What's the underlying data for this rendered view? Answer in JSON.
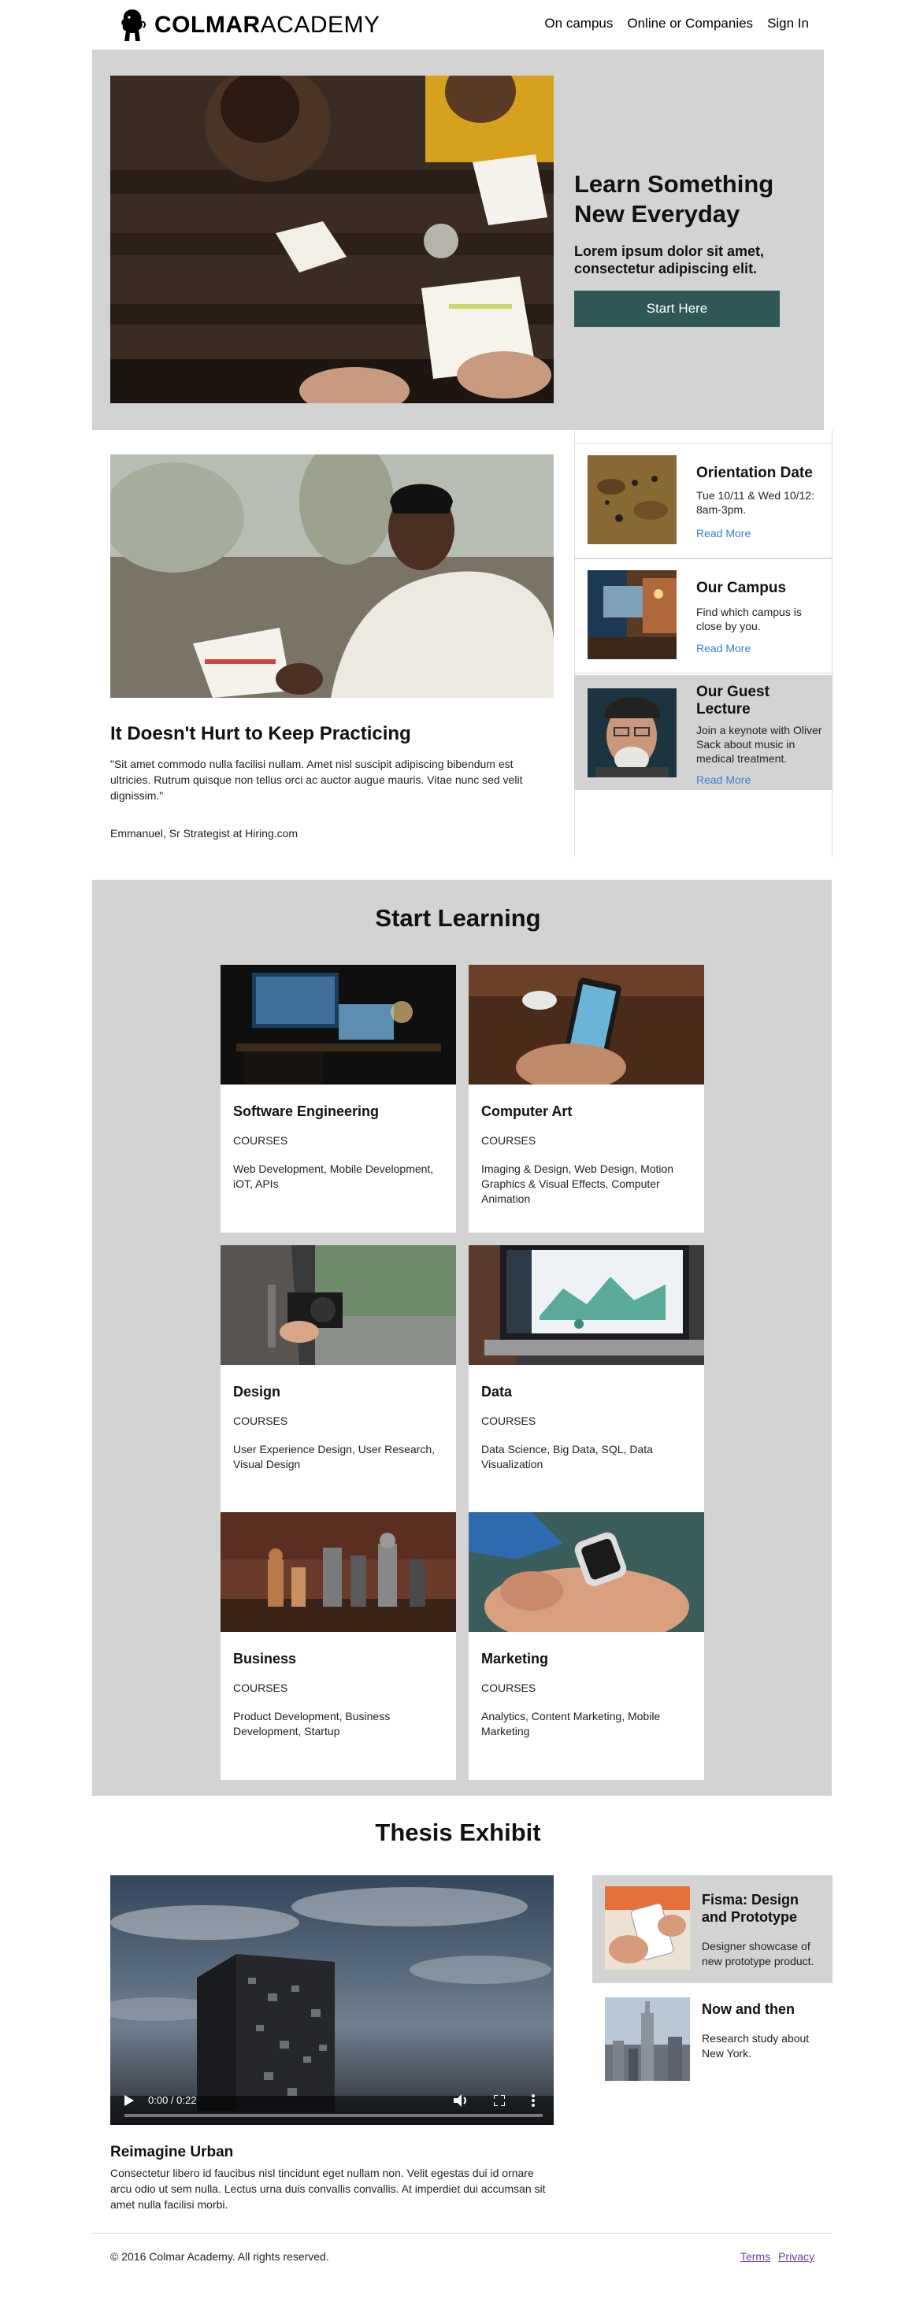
{
  "header": {
    "logo_bold": "COLMAR",
    "logo_light": "ACADEMY",
    "nav": [
      "On campus",
      "Online or Companies",
      "Sign In"
    ]
  },
  "hero": {
    "title": "Learn Something New Everyday",
    "subtitle": "Lorem ipsum dolor sit amet, consectetur adipiscing elit.",
    "button": "Start Here"
  },
  "testimonial": {
    "title": "It Doesn't Hurt to Keep Practicing",
    "quote": "\"Sit amet commodo nulla facilisi nullam. Amet nisl suscipit adipiscing bibendum est ultricies. Rutrum quisque non tellus orci ac auctor augue mauris. Vitae nunc sed velit dignissim.\"",
    "author": "Emmanuel, Sr Strategist at Hiring.com"
  },
  "events": [
    {
      "title": "Orientation Date",
      "desc": "Tue 10/11 & Wed 10/12: 8am-3pm.",
      "link": "Read More"
    },
    {
      "title": "Our Campus",
      "desc": "Find which campus is close by you.",
      "link": "Read More"
    },
    {
      "title": "Our Guest Lecture",
      "desc": "Join a keynote with Oliver Sack about music in medical treatment.",
      "link": "Read More"
    }
  ],
  "learning": {
    "title": "Start Learning",
    "courses": [
      {
        "title": "Software Engineering",
        "label": "COURSES",
        "desc": "Web Development, Mobile Development, iOT, APIs"
      },
      {
        "title": "Computer Art",
        "label": "COURSES",
        "desc": "Imaging & Design, Web Design, Motion Graphics & Visual Effects, Computer Animation"
      },
      {
        "title": "Design",
        "label": "COURSES",
        "desc": "User Experience Design, User Research, Visual Design"
      },
      {
        "title": "Data",
        "label": "COURSES",
        "desc": "Data Science, Big Data, SQL, Data Visualization"
      },
      {
        "title": "Business",
        "label": "COURSES",
        "desc": "Product Development, Business Development, Startup"
      },
      {
        "title": "Marketing",
        "label": "COURSES",
        "desc": "Analytics, Content Marketing, Mobile Marketing"
      }
    ]
  },
  "thesis": {
    "title": "Thesis Exhibit",
    "video_time": "0:00 / 0:22",
    "main_title": "Reimagine Urban",
    "main_desc": "Consectetur libero id faucibus nisl tincidunt eget nullam non. Velit egestas dui id ornare arcu odio ut sem nulla. Lectus urna duis convallis convallis. At imperdiet dui accumsan sit amet nulla facilisi morbi.",
    "projects": [
      {
        "title": "Fisma: Design and Prototype",
        "desc": "Designer showcase of new prototype product."
      },
      {
        "title": "Now and then",
        "desc": "Research study about New York."
      }
    ]
  },
  "footer": {
    "copyright": "© 2016 Colmar Academy. All rights reserved.",
    "links": [
      "Terms",
      "Privacy"
    ]
  }
}
